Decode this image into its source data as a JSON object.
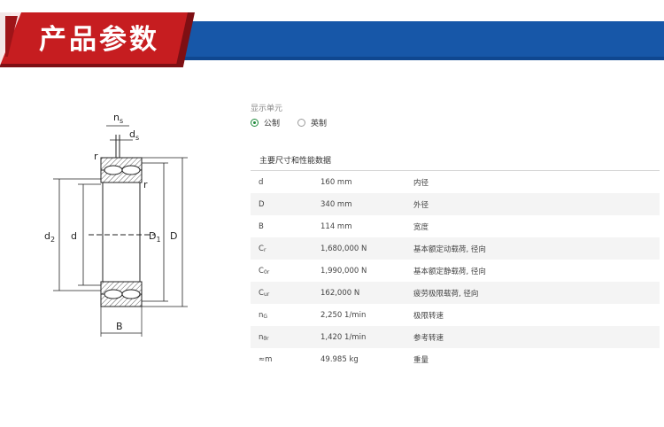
{
  "header": {
    "title": "产品参数"
  },
  "drawing": {
    "labels": {
      "ns_main": "n",
      "ns_sub": "s",
      "ds_main": "d",
      "ds_sub": "s",
      "r_top": "r",
      "r_right": "r",
      "d2_main": "d",
      "d2_sub": "2",
      "d": "d",
      "D1_main": "D",
      "D1_sub": "1",
      "D": "D",
      "B": "B"
    }
  },
  "units": {
    "label": "显示单元",
    "options": [
      {
        "label": "公制",
        "selected": true
      },
      {
        "label": "英制",
        "selected": false
      }
    ]
  },
  "section": {
    "title": "主要尺寸和性能数据"
  },
  "table": {
    "rows": [
      {
        "sym": "d",
        "sub": "",
        "value": "160 mm",
        "desc": "内径"
      },
      {
        "sym": "D",
        "sub": "",
        "value": "340 mm",
        "desc": "外径"
      },
      {
        "sym": "B",
        "sub": "",
        "value": "114 mm",
        "desc": "宽度"
      },
      {
        "sym": "C",
        "sub": "r",
        "value": "1,680,000 N",
        "desc": "基本额定动载荷, 径向"
      },
      {
        "sym": "C",
        "sub": "0r",
        "value": "1,990,000 N",
        "desc": "基本额定静载荷, 径向"
      },
      {
        "sym": "C",
        "sub": "ur",
        "value": "162,000 N",
        "desc": "疲劳极限载荷, 径向"
      },
      {
        "sym": "n",
        "sub": "G",
        "value": "2,250 1/min",
        "desc": "极限转速"
      },
      {
        "sym": "n",
        "sub": "ϑr",
        "value": "1,420 1/min",
        "desc": "参考转速"
      },
      {
        "sym": "≈m",
        "sub": "",
        "value": "49.985 kg",
        "desc": "重量"
      }
    ]
  }
}
